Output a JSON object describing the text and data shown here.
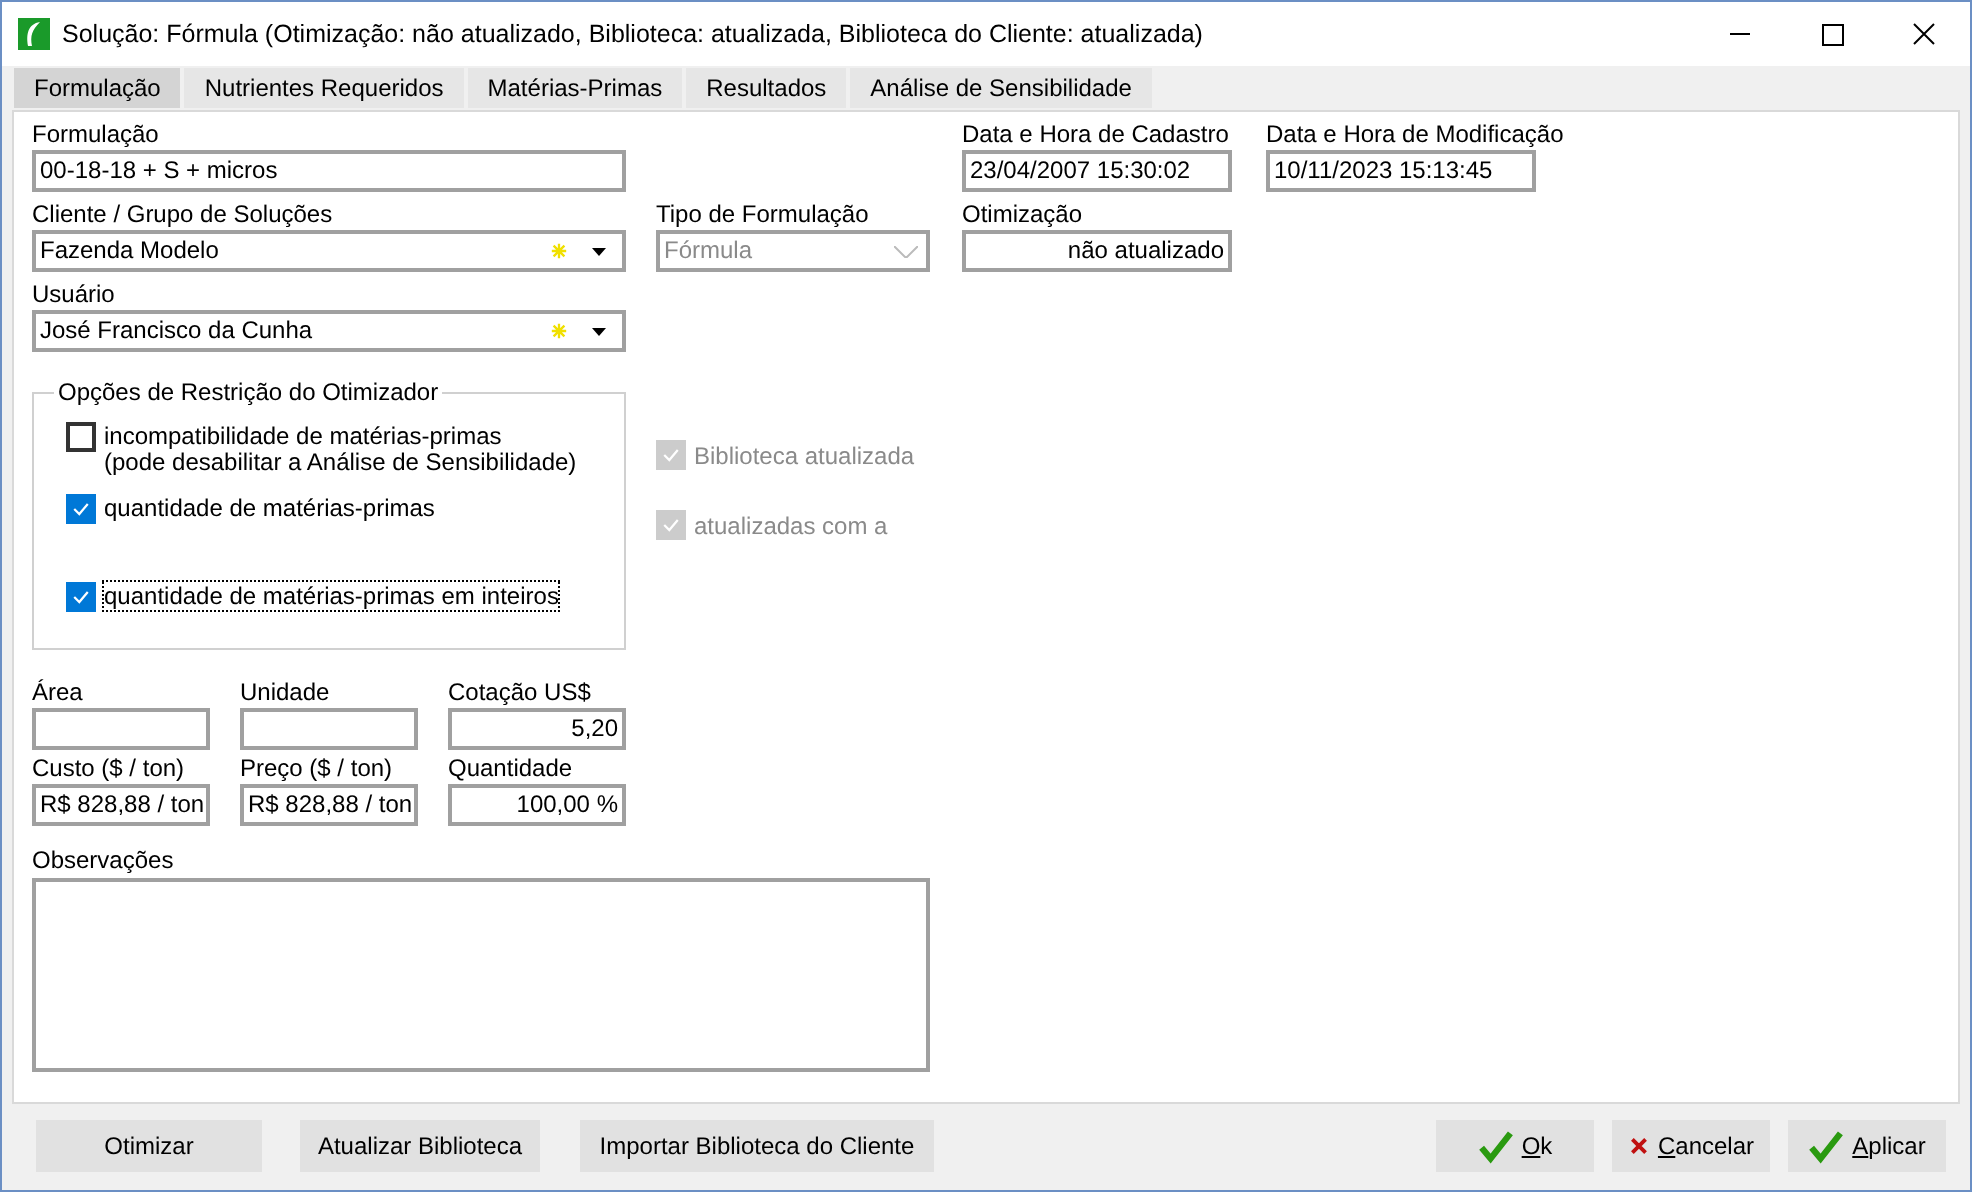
{
  "window": {
    "title": "Solução: Fórmula (Otimização: não atualizado, Biblioteca: atualizada, Biblioteca do Cliente: atualizada)"
  },
  "tabs": [
    {
      "label": "Formulação",
      "selected": true
    },
    {
      "label": "Nutrientes Requeridos",
      "selected": false
    },
    {
      "label": "Matérias-Primas",
      "selected": false
    },
    {
      "label": "Resultados",
      "selected": false
    },
    {
      "label": "Análise de Sensibilidade",
      "selected": false
    }
  ],
  "formulacao": {
    "label": "Formulação",
    "value": "00-18-18 + S + micros"
  },
  "cliente": {
    "label": "Cliente / Grupo de Soluções",
    "value": "Fazenda Modelo"
  },
  "usuario": {
    "label": "Usuário",
    "value": "José Francisco da Cunha"
  },
  "tipo": {
    "label": "Tipo de Formulação",
    "value": "Fórmula",
    "disabled": true
  },
  "cadastro": {
    "label": "Data e Hora de Cadastro",
    "value": "23/04/2007 15:30:02"
  },
  "otimizacao": {
    "label": "Otimização",
    "value": "não atualizado"
  },
  "modificacao": {
    "label": "Data e Hora de Modificação",
    "value": "10/11/2023 15:13:45"
  },
  "restricoes": {
    "title": "Opções de Restrição do Otimizador",
    "options": [
      {
        "label": "incompatibilidade de matérias-primas\n(pode desabilitar a Análise de Sensibilidade)",
        "checked": false,
        "focused": false
      },
      {
        "label": "quantidade de matérias-primas",
        "checked": true,
        "focused": false
      },
      {
        "label": "quantidade de matérias-primas em inteiros",
        "checked": true,
        "focused": true
      }
    ]
  },
  "status_checks": [
    {
      "label": "Biblioteca atualizada",
      "checked": true,
      "disabled": true
    },
    {
      "label": "atualizadas com a",
      "checked": true,
      "disabled": true
    }
  ],
  "valores": [
    {
      "label": "Área"
    },
    {
      "label": "Unidade"
    },
    {
      "label": "Cotação US$",
      "value": "5,20"
    },
    {
      "label": "Custo ($ / ton)",
      "value": "R$ 828,88 / ton"
    },
    {
      "label": "Preço ($ / ton)",
      "value": "R$ 828,88 / ton"
    },
    {
      "label": "Quantidade",
      "value": "100,00 %"
    }
  ],
  "observacoes": {
    "label": "Observações"
  },
  "buttons_left": [
    "Otimizar",
    "Atualizar Biblioteca",
    "Importar Biblioteca do Cliente"
  ],
  "buttons_right": [
    {
      "label": "Ok",
      "kind": "ok"
    },
    {
      "label": "Cancelar",
      "kind": "cancel"
    },
    {
      "label": "Aplicar",
      "kind": "ok"
    }
  ]
}
